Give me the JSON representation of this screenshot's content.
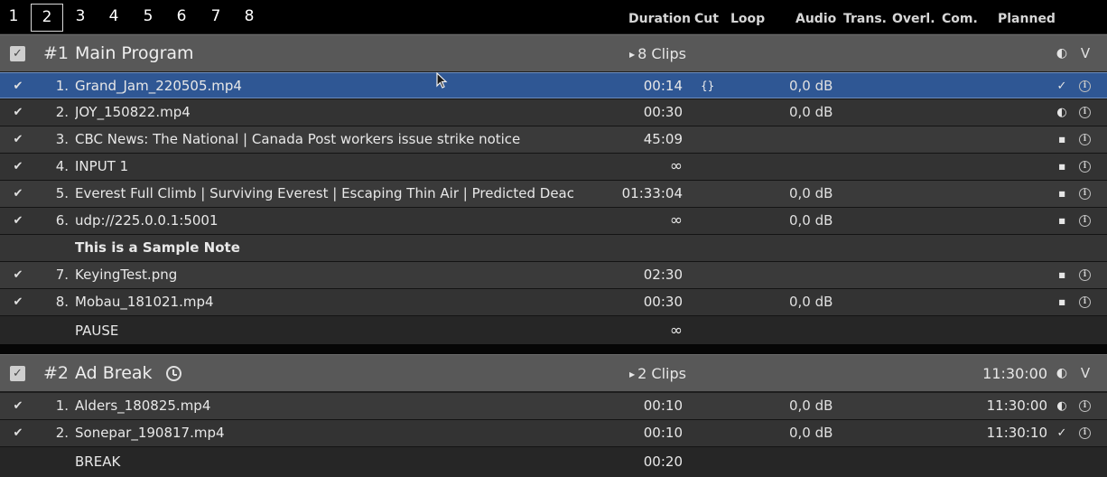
{
  "tabs": [
    "1",
    "2",
    "3",
    "4",
    "5",
    "6",
    "7",
    "8"
  ],
  "active_tab": "2",
  "columns": {
    "duration": "Duration",
    "cut": "Cut",
    "loop": "Loop",
    "audio": "Audio",
    "trans": "Trans.",
    "overl": "Overl.",
    "com": "Com.",
    "planned": "Planned"
  },
  "icons": {
    "check": "check-icon",
    "half_circle": "half-circle-icon",
    "square": "small-square-icon",
    "info": "info-icon",
    "clock": "clock-icon",
    "collapse": "chevron-down-icon"
  },
  "colors": {
    "selected_row": "#2f5794",
    "group_header": "#585858",
    "background": "#1e1e1e"
  },
  "group1": {
    "number": "#1",
    "title": "Main Program",
    "clips": "8 Clips",
    "collapse": "V",
    "items": [
      {
        "num": "1.",
        "name": "Grand_Jam_220505.mp4",
        "duration": "00:14",
        "cut": "{}",
        "audio": "0,0 dB",
        "state": "✓",
        "info": "i"
      },
      {
        "num": "2.",
        "name": "JOY_150822.mp4",
        "duration": "00:30",
        "audio": "0,0 dB",
        "state": "◐",
        "info": "i"
      },
      {
        "num": "3.",
        "name": "CBC News: The National | Canada Post workers issue strike notice",
        "duration": "45:09",
        "state": "■",
        "info": "i"
      },
      {
        "num": "4.",
        "name": "INPUT 1",
        "duration": "∞",
        "state": "■",
        "info": "i"
      },
      {
        "num": "5.",
        "name": "Everest Full Climb | Surviving Everest | Escaping Thin Air | Predicted Deac",
        "duration": "01:33:04",
        "audio": "0,0 dB",
        "state": "■",
        "info": "i"
      },
      {
        "num": "6.",
        "name": "udp://225.0.0.1:5001",
        "duration": "∞",
        "audio": "0,0 dB",
        "state": "■",
        "info": "i"
      }
    ],
    "note": "This is a Sample Note",
    "items_after_note": [
      {
        "num": "7.",
        "name": "KeyingTest.png",
        "duration": "02:30",
        "state": "■",
        "info": "i"
      },
      {
        "num": "8.",
        "name": "Mobau_181021.mp4",
        "duration": "00:30",
        "audio": "0,0 dB",
        "state": "■",
        "info": "i"
      }
    ],
    "tail": {
      "name": "PAUSE",
      "duration": "∞"
    }
  },
  "group2": {
    "number": "#2",
    "title": "Ad Break",
    "clips": "2 Clips",
    "planned": "11:30:00",
    "collapse": "V",
    "items": [
      {
        "num": "1.",
        "name": "Alders_180825.mp4",
        "duration": "00:10",
        "audio": "0,0 dB",
        "planned": "11:30:00",
        "state": "◐",
        "info": "i"
      },
      {
        "num": "2.",
        "name": "Sonepar_190817.mp4",
        "duration": "00:10",
        "audio": "0,0 dB",
        "planned": "11:30:10",
        "state": "✓",
        "info": "i"
      }
    ],
    "tail": {
      "name": "BREAK",
      "duration": "00:20"
    }
  }
}
